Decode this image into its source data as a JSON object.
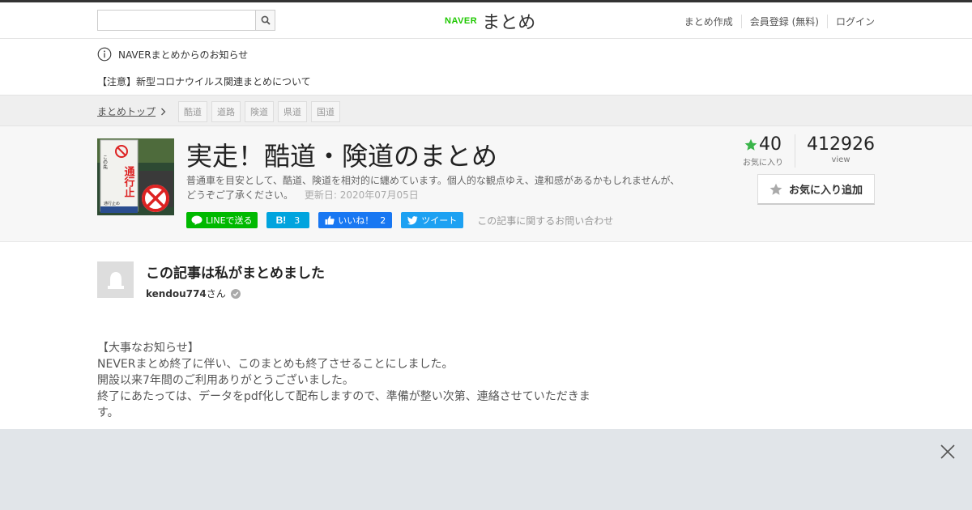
{
  "header": {
    "search_placeholder": "",
    "logo_brand": "NAVER",
    "logo_service": "まとめ",
    "links": [
      "まとめ作成",
      "会員登録 (無料)",
      "ログイン"
    ]
  },
  "notice": {
    "heading": "NAVERまとめからのお知らせ",
    "item": "【注意】新型コロナウイルス関連まとめについて"
  },
  "breadcrumb": {
    "top_label": "まとめトップ",
    "tags": [
      "酷道",
      "道路",
      "険道",
      "県道",
      "国道"
    ]
  },
  "article": {
    "title": "実走！酷道・険道のまとめ",
    "description": "普通車を目安として、酷道、険道を相対的に纏めています。個人的な観点ゆえ、違和感があるかもしれませんが、どうぞご了承ください。",
    "updated": "更新日: 2020年07月05日",
    "share": {
      "line_label": "LINEで送る",
      "hatena_count": "3",
      "fb_label": "いいね！",
      "fb_count": "2",
      "tweet_label": "ツイート"
    },
    "contact_label": "この記事に関するお問い合わせ",
    "favorites_count": "40",
    "favorites_label": "お気に入り",
    "view_count": "412926",
    "view_label": "view",
    "fav_button_label": "お気に入り追加",
    "thumbnail_sign": {
      "line1": "この先",
      "line2": "通行止",
      "small": "通行止め"
    }
  },
  "author": {
    "heading": "この記事は私がまとめました",
    "username": "kendou774",
    "suffix": "さん"
  },
  "body": {
    "lines": [
      "【大事なお知らせ】",
      "NEVERまとめ終了に伴い、このまとめも終了させることにしました。",
      "開設以来7年間のご利用ありがとうございました。",
      "終了にあたっては、データをpdf化して配布しますので、準備が整い次第、連絡させていただきます。"
    ]
  },
  "colors": {
    "accent_green": "#1ec800",
    "star_green": "#3ab54a",
    "ad_bg": "#e1e5e9"
  }
}
